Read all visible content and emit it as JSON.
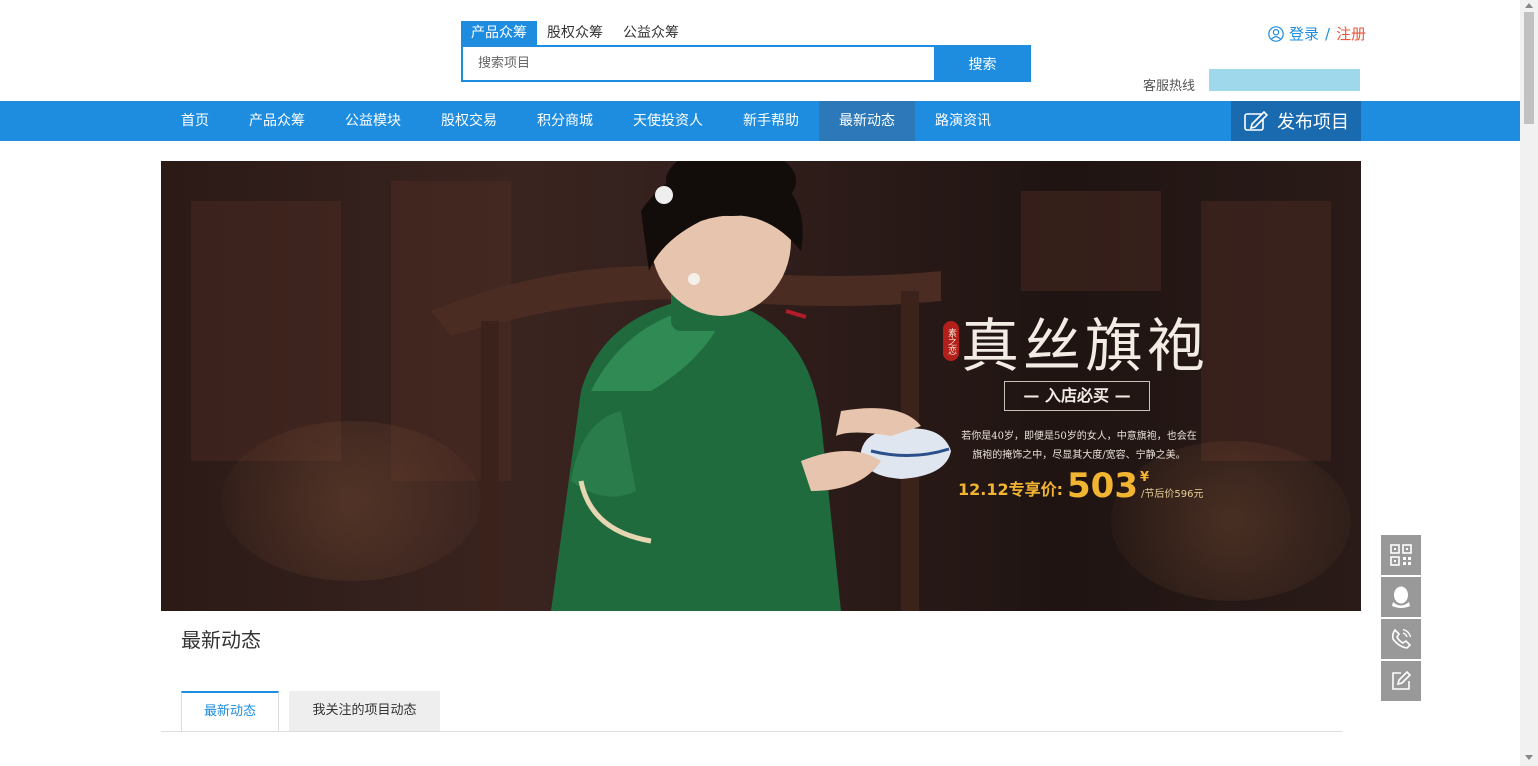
{
  "search": {
    "tabs": [
      {
        "label": "产品众筹",
        "active": true
      },
      {
        "label": "股权众筹",
        "active": false
      },
      {
        "label": "公益众筹",
        "active": false
      }
    ],
    "placeholder": "搜索项目",
    "button_label": "搜索"
  },
  "auth": {
    "login": "登录",
    "separator": "/",
    "register": "注册"
  },
  "hotline": {
    "label": "客服热线"
  },
  "nav": {
    "items": [
      {
        "label": "首页"
      },
      {
        "label": "产品众筹"
      },
      {
        "label": "公益模块"
      },
      {
        "label": "股权交易"
      },
      {
        "label": "积分商城"
      },
      {
        "label": "天使投资人"
      },
      {
        "label": "新手帮助"
      },
      {
        "label": "最新动态"
      },
      {
        "label": "路演资讯"
      }
    ],
    "active_label": "最新动态",
    "publish_label": "发布项目"
  },
  "banner": {
    "seal": "素之恋",
    "title": "真丝旗袍",
    "subtitle": "— 入店必买 —",
    "desc_line1": "若你是40岁，即便是50岁的女人，中意旗袍，也会在",
    "desc_line2": "旗袍的掩饰之中，尽显其大度/宽容、宁静之美。",
    "price_label": "12.12专享价:",
    "price_value": "503",
    "price_currency": "¥",
    "price_original": "/节后价596元"
  },
  "section": {
    "title": "最新动态",
    "tabs": [
      {
        "label": "最新动态",
        "active": true
      },
      {
        "label": "我关注的项目动态",
        "active": false
      }
    ]
  },
  "side_tools": [
    "qr-code-icon",
    "qq-icon",
    "phone-icon",
    "edit-icon"
  ],
  "colors": {
    "primary": "#1e8de0",
    "nav_active": "#2c78b8",
    "publish_bg": "#1a6ab0",
    "register": "#e8573a",
    "price": "#f2b532",
    "side_tool": "#999999"
  }
}
